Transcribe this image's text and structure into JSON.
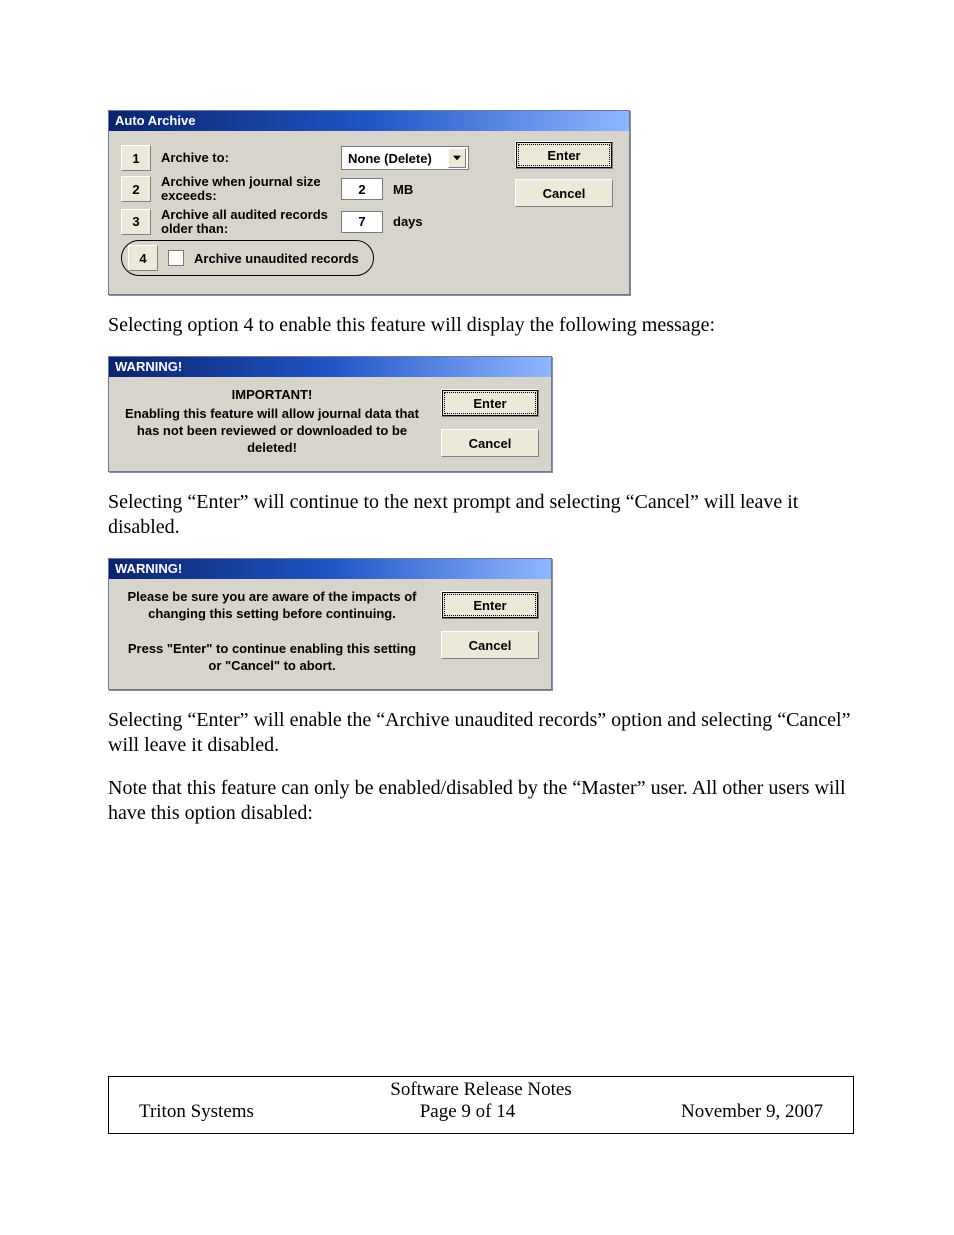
{
  "autoArchive": {
    "title": "Auto Archive",
    "rows": {
      "r1": {
        "num": "1",
        "label": "Archive to:",
        "dropdown": "None (Delete)"
      },
      "r2": {
        "num": "2",
        "label": "Archive when journal size exceeds:",
        "value": "2",
        "unit": "MB"
      },
      "r3": {
        "num": "3",
        "label": "Archive all audited records older than:",
        "value": "7",
        "unit": "days"
      },
      "r4": {
        "num": "4",
        "label": "Archive unaudited records"
      }
    },
    "enter": "Enter",
    "cancel": "Cancel"
  },
  "para1": "Selecting option 4 to enable this feature will display the following message:",
  "warn1": {
    "title": "WARNING!",
    "heading": "IMPORTANT!",
    "msg": "Enabling this feature will allow journal data that has not been reviewed or downloaded to be deleted!",
    "enter": "Enter",
    "cancel": "Cancel"
  },
  "para2": "Selecting “Enter” will continue to the next prompt and selecting “Cancel” will leave it disabled.",
  "warn2": {
    "title": "WARNING!",
    "msg1": "Please be sure you are aware of the impacts of changing this setting before continuing.",
    "msg2": "Press \"Enter\" to continue enabling this setting or \"Cancel\" to abort.",
    "enter": "Enter",
    "cancel": "Cancel"
  },
  "para3": "Selecting “Enter” will enable the “Archive unaudited records” option and selecting “Cancel” will leave it disabled.",
  "para4": "Note that this feature can only be enabled/disabled by the “Master” user.  All other users will have this option disabled:",
  "footer": {
    "title": "Software Release Notes",
    "left": "Triton Systems",
    "center": "Page 9 of 14",
    "right": "November 9, 2007"
  }
}
